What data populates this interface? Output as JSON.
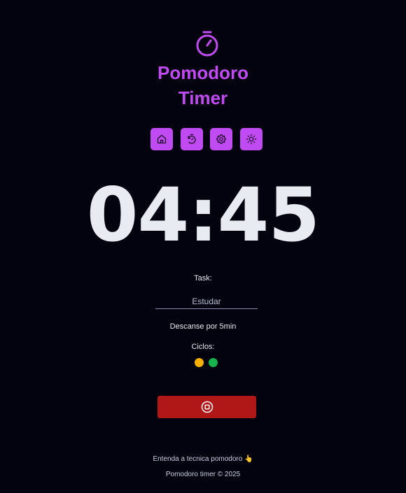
{
  "header": {
    "title_line1": "Pomodoro",
    "title_line2": "Timer",
    "logo_icon": "stopwatch-icon",
    "accent_color": "#c04bf2"
  },
  "toolbar": {
    "buttons": [
      {
        "icon": "home-icon"
      },
      {
        "icon": "timer-reset-icon"
      },
      {
        "icon": "gear-icon"
      },
      {
        "icon": "sun-icon"
      }
    ]
  },
  "timer": {
    "display": "04:45"
  },
  "task": {
    "label": "Task:",
    "value": "Estudar"
  },
  "status": {
    "text": "Descanse por 5min"
  },
  "cycles": {
    "label": "Ciclos:",
    "dots": [
      {
        "state": "current",
        "color": "#f5b000"
      },
      {
        "state": "done",
        "color": "#16b44c"
      }
    ]
  },
  "controls": {
    "stop_icon": "stop-circle-icon",
    "stop_color": "#b01717"
  },
  "footer": {
    "link_text": "Entenda a tecnica pomodoro",
    "link_icon": "click-hand-icon",
    "copyright": "Pomodoro timer © 2025"
  }
}
